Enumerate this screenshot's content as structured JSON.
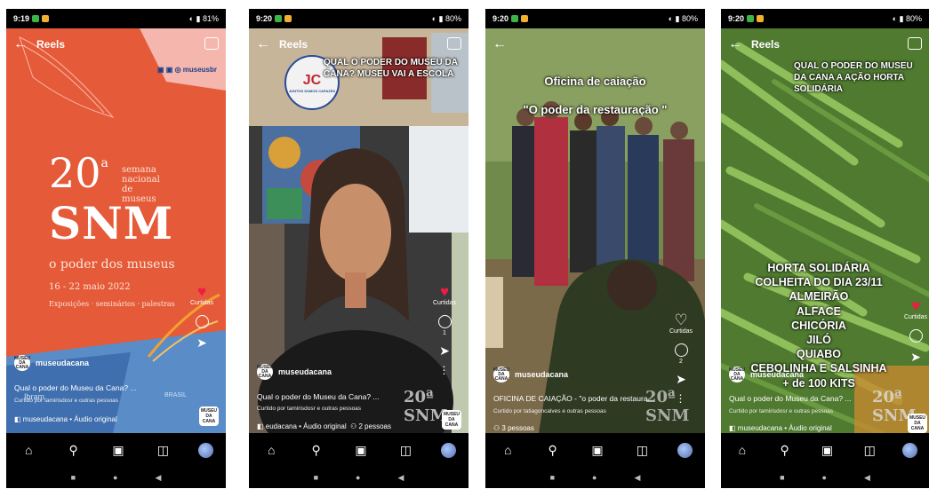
{
  "common": {
    "reels_title": "Reels",
    "liked_label": "Curtidas",
    "nav_icons": [
      "home-icon",
      "search-icon",
      "reels-icon",
      "shop-icon",
      "profile-avatar"
    ]
  },
  "phones": [
    {
      "time": "9:19",
      "battery": "81",
      "owner": "museudacana",
      "avatar_text": "MUSEU DA CANA",
      "caption": "Qual o poder do Museu da Cana? ...",
      "liked_by": "Curtido por tamirisdosr e outras pessoas",
      "audio": "museudacana • Áudio original",
      "poster": {
        "social": "museusbr",
        "edition_num": "20",
        "edition_sup": "a",
        "edition_text_1": "semana",
        "edition_text_2": "nacional",
        "edition_text_3": "de museus",
        "acronym": "SNM",
        "theme": "o poder dos museus",
        "dates": "16 - 22 maio 2022",
        "events": "Exposições · seminários · palestras",
        "footer_1": "Ibram",
        "footer_2": "BRASIL"
      }
    },
    {
      "time": "9:20",
      "battery": "80",
      "owner": "museudacana",
      "avatar_text": "MUSEU DA CANA",
      "overlay": "QUAL O PODER DO MUSEU DA CANA? MUSEU VAI A ESCOLA",
      "badge": "JC",
      "badge_motto": "JUNTOS SOMOS CAPAZES",
      "caption": "Qual o poder do Museu da Cana? ...",
      "liked_by": "Curtido por tamirisdosr e outras pessoas",
      "audio": "eudacana • Áudio original",
      "people": "2 pessoas",
      "count": "1",
      "mini": "20ª SNM"
    },
    {
      "time": "9:20",
      "battery": "80",
      "owner": "museudacana",
      "avatar_text": "MUSEU DA CANA",
      "overlay_1": "Oficina de caiação",
      "overlay_2": "\"O poder da restauração \"",
      "caption": "OFICINA DE CAIAÇÃO - \"o poder da restaura...",
      "liked_by": "Curtido por tatiagoncalves e outras pessoas",
      "people": "3 pessoas",
      "count": "2",
      "mini": "20ª SNM"
    },
    {
      "time": "9:20",
      "battery": "80",
      "owner": "museudacana",
      "avatar_text": "MUSEU DA CANA",
      "overlay": "QUAL O PODER DO MUSEU DA CANA A AÇÃO HORTA SOLIDÁRIA",
      "list": [
        "HORTA SOLIDÁRIA",
        "COLHEITA DO DIA 23/11",
        "ALMEIRÃO",
        "ALFACE",
        "CHICÓRIA",
        "JILÓ",
        "QUIABO",
        "CEBOLINHA E SALSINHA",
        "+ de 100 KITS"
      ],
      "caption": "Qual o poder do Museu da Cana? ...",
      "liked_by": "Curtido por tamirisdosr e outras pessoas",
      "audio": "museudacana • Áudio original",
      "mini": "20ª SNM"
    }
  ]
}
